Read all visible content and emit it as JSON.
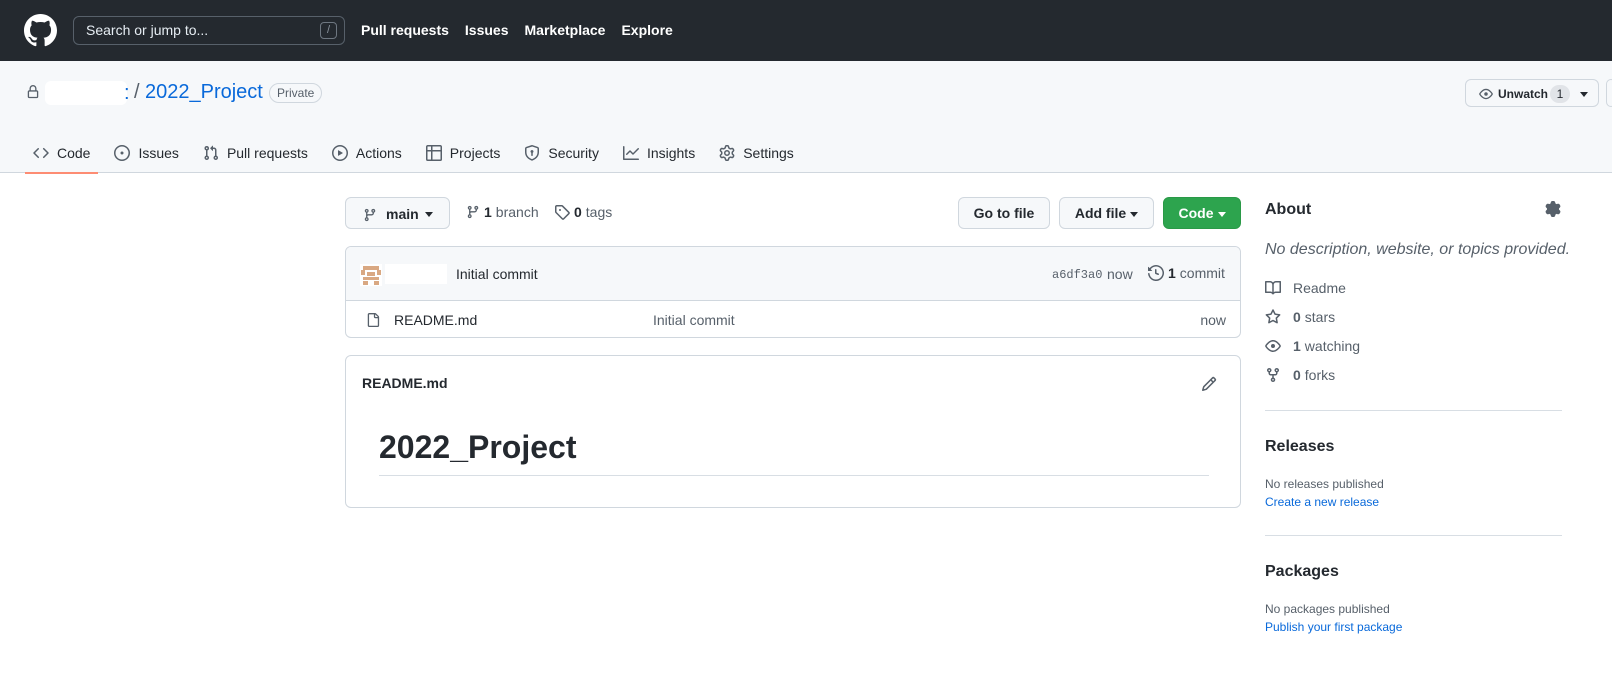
{
  "header": {
    "search_placeholder": "Search or jump to...",
    "search_shortcut": "/",
    "nav": [
      "Pull requests",
      "Issues",
      "Marketplace",
      "Explore"
    ]
  },
  "repo": {
    "owner_suffix": ":",
    "separator": "/",
    "name": "2022_Project",
    "visibility": "Private",
    "unwatch_label": "Unwatch",
    "watch_count": "1"
  },
  "tabs": [
    {
      "label": "Code",
      "icon": "code-icon",
      "active": true
    },
    {
      "label": "Issues",
      "icon": "issue-icon"
    },
    {
      "label": "Pull requests",
      "icon": "pull-request-icon"
    },
    {
      "label": "Actions",
      "icon": "play-icon"
    },
    {
      "label": "Projects",
      "icon": "table-icon"
    },
    {
      "label": "Security",
      "icon": "shield-icon"
    },
    {
      "label": "Insights",
      "icon": "graph-icon"
    },
    {
      "label": "Settings",
      "icon": "gear-icon"
    }
  ],
  "toolbar": {
    "branch": "main",
    "branch_count": "1",
    "branch_word": "branch",
    "tag_count": "0",
    "tag_word": "tags",
    "goto_file": "Go to file",
    "add_file": "Add file",
    "code": "Code"
  },
  "commit": {
    "message": "Initial commit",
    "sha": "a6df3a0",
    "time": "now",
    "count": "1",
    "count_word": "commit"
  },
  "files": [
    {
      "name": "README.md",
      "message": "Initial commit",
      "time": "now"
    }
  ],
  "readme": {
    "title": "README.md",
    "heading": "2022_Project"
  },
  "about": {
    "title": "About",
    "description": "No description, website, or topics provided.",
    "readme": "Readme",
    "stars_count": "0",
    "stars_word": "stars",
    "watching_count": "1",
    "watching_word": "watching",
    "forks_count": "0",
    "forks_word": "forks"
  },
  "releases": {
    "title": "Releases",
    "note": "No releases published",
    "link": "Create a new release"
  },
  "packages": {
    "title": "Packages",
    "note": "No packages published",
    "link": "Publish your first package"
  },
  "colors": {
    "header_bg": "#24292f",
    "link": "#0969da",
    "primary_button": "#2da44e",
    "active_tab_underline": "#fd8c73"
  }
}
